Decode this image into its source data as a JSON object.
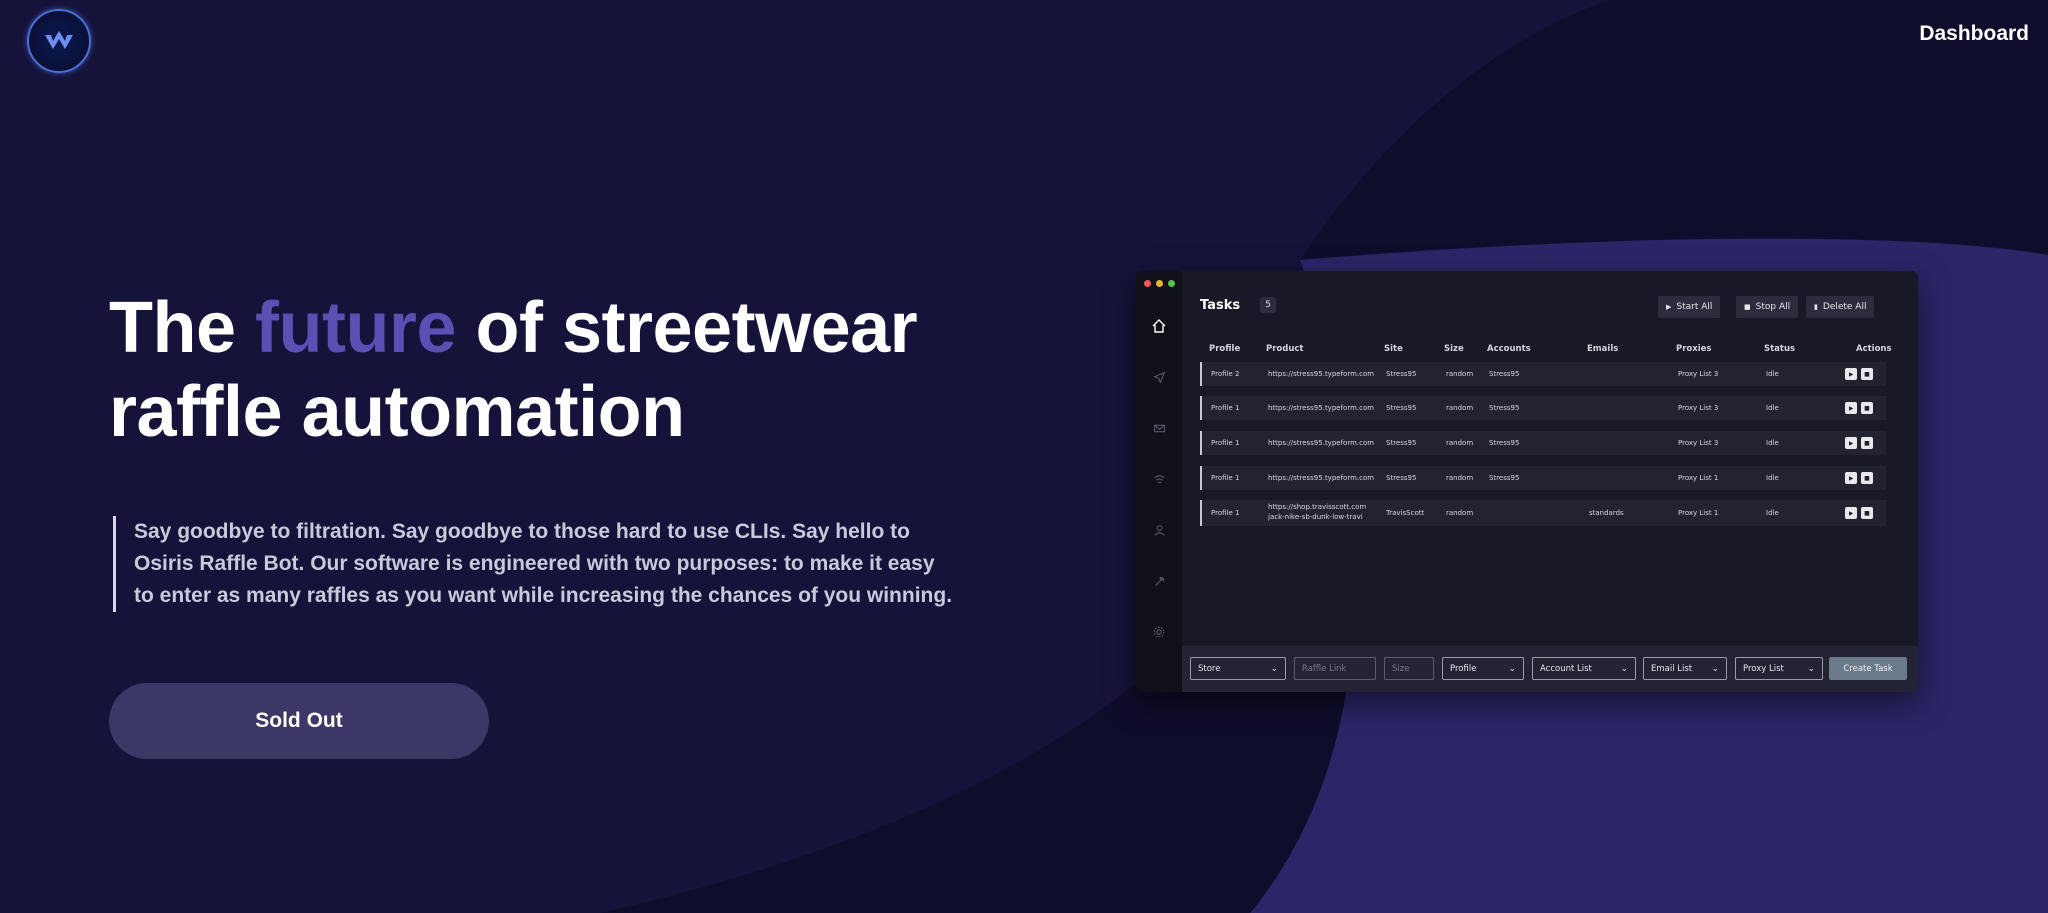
{
  "brand": {
    "logo_icon": "osiris-logo"
  },
  "nav": {
    "dashboard": "Dashboard"
  },
  "hero": {
    "headline_pre": "The ",
    "headline_accent": "future",
    "headline_line1_post": " of streetwear",
    "headline_line2": "raffle automation",
    "description": "Say goodbye to filtration. Say goodbye to those hard to use CLIs. Say hello to Osiris Raffle Bot. Our software is engineered with two purposes: to make it easy to enter as many raffles as you want while increasing the chances of you winning.",
    "cta": "Sold Out",
    "accent_color": "#5b4fb3"
  },
  "app": {
    "title": "Tasks",
    "count": "5",
    "buttons": {
      "start_all": "Start All",
      "stop_all": "Stop All",
      "delete_all": "Delete All"
    },
    "columns": [
      "Profile",
      "Product",
      "Site",
      "Size",
      "Accounts",
      "Emails",
      "Proxies",
      "Status",
      "Actions"
    ],
    "rows": [
      {
        "profile": "Profile 2",
        "product": "https://stress95.typeform.com",
        "site": "Stress95",
        "size": "random",
        "accounts": "Stress95",
        "emails": "",
        "proxies": "Proxy List 3",
        "status": "Idle"
      },
      {
        "profile": "Profile 1",
        "product": "https://stress95.typeform.com",
        "site": "Stress95",
        "size": "random",
        "accounts": "Stress95",
        "emails": "",
        "proxies": "Proxy List 3",
        "status": "Idle"
      },
      {
        "profile": "Profile 1",
        "product": "https://stress95.typeform.com",
        "site": "Stress95",
        "size": "random",
        "accounts": "Stress95",
        "emails": "",
        "proxies": "Proxy List 3",
        "status": "Idle"
      },
      {
        "profile": "Profile 1",
        "product": "https://stress95.typeform.com",
        "site": "Stress95",
        "size": "random",
        "accounts": "Stress95",
        "emails": "",
        "proxies": "Proxy List 1",
        "status": "Idle"
      },
      {
        "profile": "Profile 1",
        "product_line1": "https://shop.travisscott.com",
        "product_line2": "jack-nike-sb-dunk-low-travi",
        "site": "TravisScott",
        "size": "random",
        "accounts": "",
        "emails": "standards",
        "proxies": "Proxy List 1",
        "status": "Idle"
      }
    ],
    "bottom": {
      "store": "Store",
      "raffle_link_placeholder": "Raffle Link",
      "size_placeholder": "Size",
      "profile": "Profile",
      "account_list": "Account List",
      "email_list": "Email List",
      "proxy_list": "Proxy List",
      "create_task": "Create Task"
    },
    "sidebar_icons": [
      "home-icon",
      "send-icon",
      "mail-icon",
      "wifi-icon",
      "user-icon",
      "tools-icon",
      "settings-icon"
    ]
  }
}
